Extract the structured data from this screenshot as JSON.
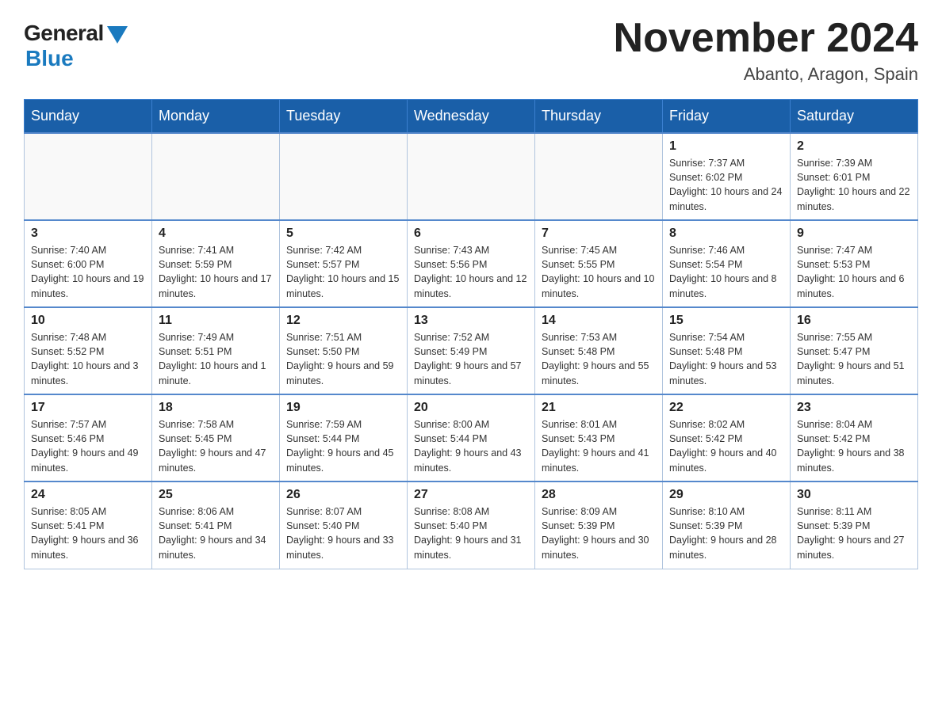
{
  "header": {
    "logo_general": "General",
    "logo_blue": "Blue",
    "month_title": "November 2024",
    "location": "Abanto, Aragon, Spain"
  },
  "weekdays": [
    "Sunday",
    "Monday",
    "Tuesday",
    "Wednesday",
    "Thursday",
    "Friday",
    "Saturday"
  ],
  "weeks": [
    [
      {
        "day": "",
        "info": ""
      },
      {
        "day": "",
        "info": ""
      },
      {
        "day": "",
        "info": ""
      },
      {
        "day": "",
        "info": ""
      },
      {
        "day": "",
        "info": ""
      },
      {
        "day": "1",
        "info": "Sunrise: 7:37 AM\nSunset: 6:02 PM\nDaylight: 10 hours and 24 minutes."
      },
      {
        "day": "2",
        "info": "Sunrise: 7:39 AM\nSunset: 6:01 PM\nDaylight: 10 hours and 22 minutes."
      }
    ],
    [
      {
        "day": "3",
        "info": "Sunrise: 7:40 AM\nSunset: 6:00 PM\nDaylight: 10 hours and 19 minutes."
      },
      {
        "day": "4",
        "info": "Sunrise: 7:41 AM\nSunset: 5:59 PM\nDaylight: 10 hours and 17 minutes."
      },
      {
        "day": "5",
        "info": "Sunrise: 7:42 AM\nSunset: 5:57 PM\nDaylight: 10 hours and 15 minutes."
      },
      {
        "day": "6",
        "info": "Sunrise: 7:43 AM\nSunset: 5:56 PM\nDaylight: 10 hours and 12 minutes."
      },
      {
        "day": "7",
        "info": "Sunrise: 7:45 AM\nSunset: 5:55 PM\nDaylight: 10 hours and 10 minutes."
      },
      {
        "day": "8",
        "info": "Sunrise: 7:46 AM\nSunset: 5:54 PM\nDaylight: 10 hours and 8 minutes."
      },
      {
        "day": "9",
        "info": "Sunrise: 7:47 AM\nSunset: 5:53 PM\nDaylight: 10 hours and 6 minutes."
      }
    ],
    [
      {
        "day": "10",
        "info": "Sunrise: 7:48 AM\nSunset: 5:52 PM\nDaylight: 10 hours and 3 minutes."
      },
      {
        "day": "11",
        "info": "Sunrise: 7:49 AM\nSunset: 5:51 PM\nDaylight: 10 hours and 1 minute."
      },
      {
        "day": "12",
        "info": "Sunrise: 7:51 AM\nSunset: 5:50 PM\nDaylight: 9 hours and 59 minutes."
      },
      {
        "day": "13",
        "info": "Sunrise: 7:52 AM\nSunset: 5:49 PM\nDaylight: 9 hours and 57 minutes."
      },
      {
        "day": "14",
        "info": "Sunrise: 7:53 AM\nSunset: 5:48 PM\nDaylight: 9 hours and 55 minutes."
      },
      {
        "day": "15",
        "info": "Sunrise: 7:54 AM\nSunset: 5:48 PM\nDaylight: 9 hours and 53 minutes."
      },
      {
        "day": "16",
        "info": "Sunrise: 7:55 AM\nSunset: 5:47 PM\nDaylight: 9 hours and 51 minutes."
      }
    ],
    [
      {
        "day": "17",
        "info": "Sunrise: 7:57 AM\nSunset: 5:46 PM\nDaylight: 9 hours and 49 minutes."
      },
      {
        "day": "18",
        "info": "Sunrise: 7:58 AM\nSunset: 5:45 PM\nDaylight: 9 hours and 47 minutes."
      },
      {
        "day": "19",
        "info": "Sunrise: 7:59 AM\nSunset: 5:44 PM\nDaylight: 9 hours and 45 minutes."
      },
      {
        "day": "20",
        "info": "Sunrise: 8:00 AM\nSunset: 5:44 PM\nDaylight: 9 hours and 43 minutes."
      },
      {
        "day": "21",
        "info": "Sunrise: 8:01 AM\nSunset: 5:43 PM\nDaylight: 9 hours and 41 minutes."
      },
      {
        "day": "22",
        "info": "Sunrise: 8:02 AM\nSunset: 5:42 PM\nDaylight: 9 hours and 40 minutes."
      },
      {
        "day": "23",
        "info": "Sunrise: 8:04 AM\nSunset: 5:42 PM\nDaylight: 9 hours and 38 minutes."
      }
    ],
    [
      {
        "day": "24",
        "info": "Sunrise: 8:05 AM\nSunset: 5:41 PM\nDaylight: 9 hours and 36 minutes."
      },
      {
        "day": "25",
        "info": "Sunrise: 8:06 AM\nSunset: 5:41 PM\nDaylight: 9 hours and 34 minutes."
      },
      {
        "day": "26",
        "info": "Sunrise: 8:07 AM\nSunset: 5:40 PM\nDaylight: 9 hours and 33 minutes."
      },
      {
        "day": "27",
        "info": "Sunrise: 8:08 AM\nSunset: 5:40 PM\nDaylight: 9 hours and 31 minutes."
      },
      {
        "day": "28",
        "info": "Sunrise: 8:09 AM\nSunset: 5:39 PM\nDaylight: 9 hours and 30 minutes."
      },
      {
        "day": "29",
        "info": "Sunrise: 8:10 AM\nSunset: 5:39 PM\nDaylight: 9 hours and 28 minutes."
      },
      {
        "day": "30",
        "info": "Sunrise: 8:11 AM\nSunset: 5:39 PM\nDaylight: 9 hours and 27 minutes."
      }
    ]
  ]
}
